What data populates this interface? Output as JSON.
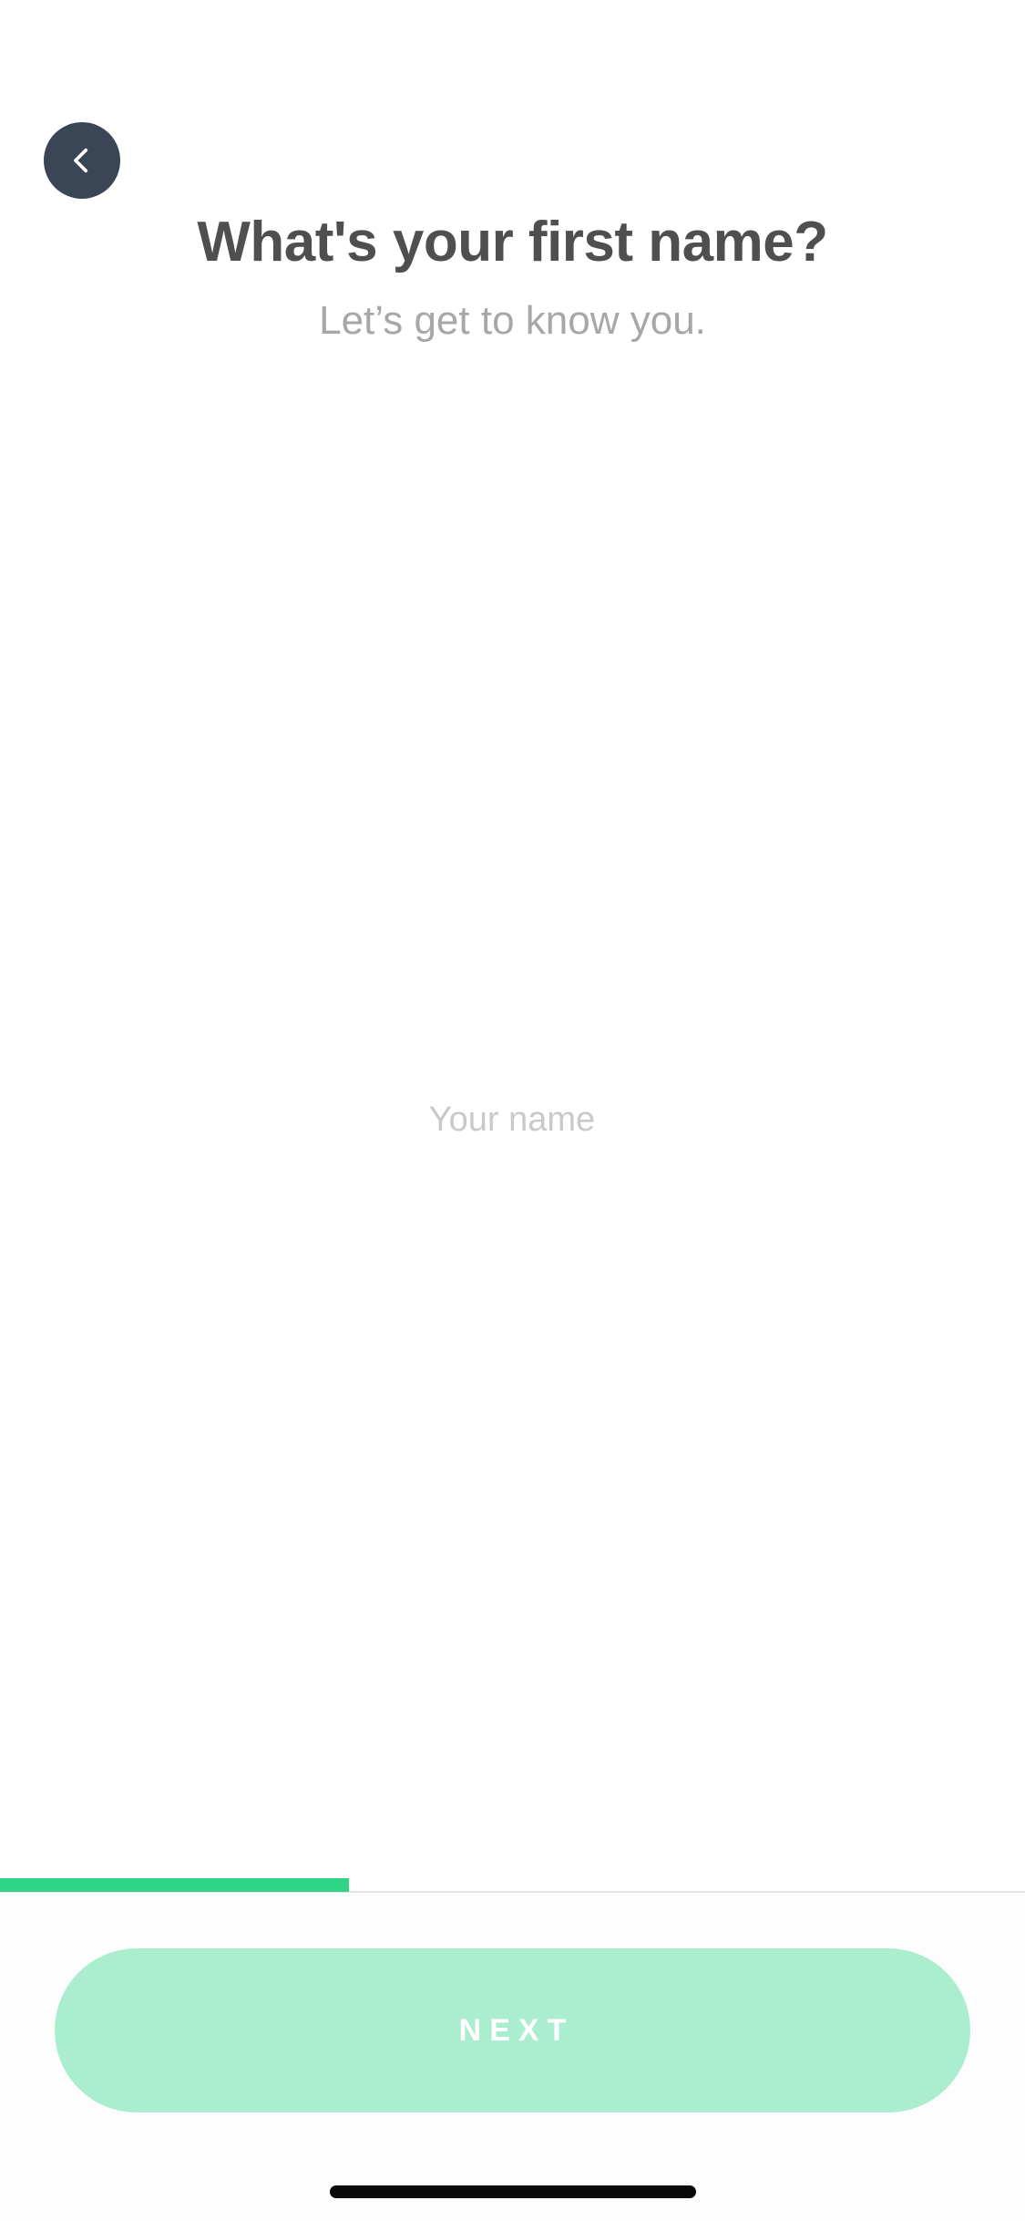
{
  "header": {
    "back_icon": "chevron-left-icon",
    "back_button_color": "#3a4556",
    "title": "What's your first name?",
    "subtitle": "Let’s get to know you."
  },
  "form": {
    "name_placeholder": "Your name",
    "name_value": ""
  },
  "progress": {
    "fraction": 0.34,
    "color": "#2fd584"
  },
  "footer": {
    "next_label": "NEXT",
    "next_button_color": "#abedcf"
  }
}
